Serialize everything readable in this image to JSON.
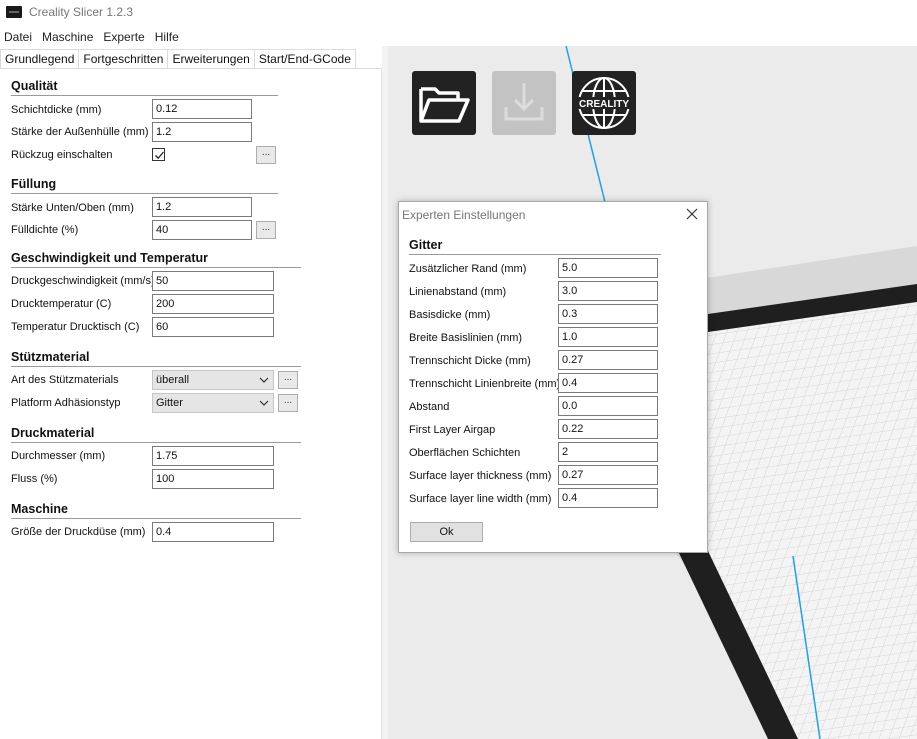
{
  "app": {
    "title": "Creality Slicer 1.2.3"
  },
  "menu": [
    "Datei",
    "Maschine",
    "Experte",
    "Hilfe"
  ],
  "tabs": [
    "Grundlegend",
    "Fortgeschritten",
    "Erweiterungen",
    "Start/End-GCode"
  ],
  "sections": {
    "qualitaet": {
      "title": "Qualität",
      "schichtdicke_label": "Schichtdicke (mm)",
      "schichtdicke_value": "0.12",
      "aussenhuelle_label": "Stärke der Außenhülle (mm)",
      "aussenhuelle_value": "1.2",
      "rueckzug_label": "Rückzug einschalten",
      "rueckzug_checked": true
    },
    "fuellung": {
      "title": "Füllung",
      "unten_oben_label": "Stärke Unten/Oben (mm)",
      "unten_oben_value": "1.2",
      "fuelldichte_label": "Fülldichte (%)",
      "fuelldichte_value": "40"
    },
    "geschwindigkeit": {
      "title": "Geschwindigkeit und Temperatur",
      "druckgeschwindigkeit_label": "Druckgeschwindigkeit (mm/s)",
      "druckgeschwindigkeit_value": "50",
      "drucktemperatur_label": "Drucktemperatur (C)",
      "drucktemperatur_value": "200",
      "drucktisch_label": "Temperatur Drucktisch (C)",
      "drucktisch_value": "60"
    },
    "stuetzmaterial": {
      "title": "Stützmaterial",
      "art_label": "Art des Stützmaterials",
      "art_value": "überall",
      "adhaesion_label": "Platform Adhäsionstyp",
      "adhaesion_value": "Gitter"
    },
    "druckmaterial": {
      "title": "Druckmaterial",
      "durchmesser_label": "Durchmesser (mm)",
      "durchmesser_value": "1.75",
      "fluss_label": "Fluss (%)",
      "fluss_value": "100"
    },
    "maschine": {
      "title": "Maschine",
      "duese_label": "Größe der Druckdüse (mm)",
      "duese_value": "0.4"
    }
  },
  "buttons": {
    "dots": "..."
  },
  "toolbar": {
    "creality_label": "CREALITY"
  },
  "dialog": {
    "title": "Experten Einstellungen",
    "section": "Gitter",
    "rows": [
      {
        "label": "Zusätzlicher Rand (mm)",
        "value": "5.0"
      },
      {
        "label": "Linienabstand (mm)",
        "value": "3.0"
      },
      {
        "label": "Basisdicke (mm)",
        "value": "0.3"
      },
      {
        "label": "Breite Basislinien (mm)",
        "value": "1.0"
      },
      {
        "label": "Trennschicht Dicke (mm)",
        "value": "0.27"
      },
      {
        "label": "Trennschicht Linienbreite (mm)",
        "value": "0.4"
      },
      {
        "label": "Abstand",
        "value": "0.0"
      },
      {
        "label": "First Layer Airgap",
        "value": "0.22"
      },
      {
        "label": "Oberflächen Schichten",
        "value": "2"
      },
      {
        "label": "Surface layer thickness (mm)",
        "value": "0.27"
      },
      {
        "label": "Surface layer line width (mm)",
        "value": "0.4"
      }
    ],
    "ok_label": "Ok"
  },
  "colors": {
    "build_plate_outline": "#1f1f1f",
    "nozzle_guide_line": "#1aa3e8",
    "grid_line": "#d2d2d2"
  }
}
